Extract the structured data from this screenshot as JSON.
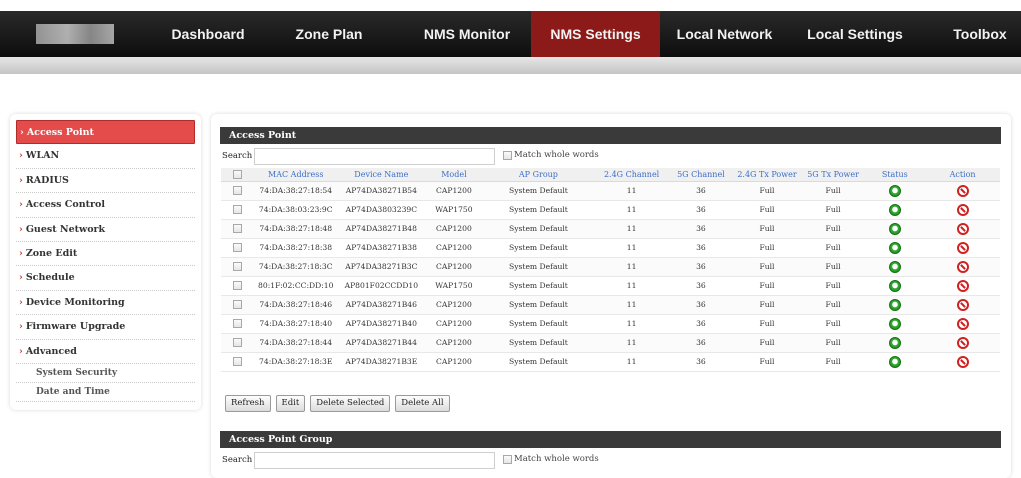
{
  "nav": {
    "logo_alt": "",
    "items": [
      "Dashboard",
      "Zone Plan",
      "NMS Monitor",
      "NMS Settings",
      "Local Network",
      "Local Settings",
      "Toolbox"
    ],
    "active_index": 3,
    "active_color": "#8b1a18"
  },
  "sidebar": {
    "items": [
      {
        "label": "Access Point",
        "active": true
      },
      {
        "label": "WLAN"
      },
      {
        "label": "RADIUS"
      },
      {
        "label": "Access Control"
      },
      {
        "label": "Guest Network"
      },
      {
        "label": "Zone Edit"
      },
      {
        "label": "Schedule"
      },
      {
        "label": "Device Monitoring"
      },
      {
        "label": "Firmware Upgrade"
      },
      {
        "label": "Advanced"
      }
    ],
    "sub_items": [
      "System Security",
      "Date and Time"
    ],
    "active_color": "#e44c4c"
  },
  "access_point": {
    "title": "Access Point",
    "search_label": "Search",
    "search_value": "",
    "match_label": "Match whole words",
    "columns": [
      "",
      "MAC Address",
      "Device Name",
      "Model",
      "AP Group",
      "2.4G Channel",
      "5G Channel",
      "2.4G Tx Power",
      "5G Tx Power",
      "Status",
      "Action"
    ],
    "rows": [
      {
        "mac": "74:DA:38:27:18:54",
        "name": "AP74DA38271B54",
        "model": "CAP1200",
        "group": "System Default",
        "ch24": "11",
        "ch5": "36",
        "tx24": "Full",
        "tx5": "Full"
      },
      {
        "mac": "74:DA:38:03:23:9C",
        "name": "AP74DA3803239C",
        "model": "WAP1750",
        "group": "System Default",
        "ch24": "11",
        "ch5": "36",
        "tx24": "Full",
        "tx5": "Full"
      },
      {
        "mac": "74:DA:38:27:18:48",
        "name": "AP74DA38271B48",
        "model": "CAP1200",
        "group": "System Default",
        "ch24": "11",
        "ch5": "36",
        "tx24": "Full",
        "tx5": "Full"
      },
      {
        "mac": "74:DA:38:27:18:38",
        "name": "AP74DA38271B38",
        "model": "CAP1200",
        "group": "System Default",
        "ch24": "11",
        "ch5": "36",
        "tx24": "Full",
        "tx5": "Full"
      },
      {
        "mac": "74:DA:38:27:18:3C",
        "name": "AP74DA38271B3C",
        "model": "CAP1200",
        "group": "System Default",
        "ch24": "11",
        "ch5": "36",
        "tx24": "Full",
        "tx5": "Full"
      },
      {
        "mac": "80:1F:02:CC:DD:10",
        "name": "AP801F02CCDD10",
        "model": "WAP1750",
        "group": "System Default",
        "ch24": "11",
        "ch5": "36",
        "tx24": "Full",
        "tx5": "Full"
      },
      {
        "mac": "74:DA:38:27:18:46",
        "name": "AP74DA38271B46",
        "model": "CAP1200",
        "group": "System Default",
        "ch24": "11",
        "ch5": "36",
        "tx24": "Full",
        "tx5": "Full"
      },
      {
        "mac": "74:DA:38:27:18:40",
        "name": "AP74DA38271B40",
        "model": "CAP1200",
        "group": "System Default",
        "ch24": "11",
        "ch5": "36",
        "tx24": "Full",
        "tx5": "Full"
      },
      {
        "mac": "74:DA:38:27:18:44",
        "name": "AP74DA38271B44",
        "model": "CAP1200",
        "group": "System Default",
        "ch24": "11",
        "ch5": "36",
        "tx24": "Full",
        "tx5": "Full"
      },
      {
        "mac": "74:DA:38:27:18:3E",
        "name": "AP74DA38271B3E",
        "model": "CAP1200",
        "group": "System Default",
        "ch24": "11",
        "ch5": "36",
        "tx24": "Full",
        "tx5": "Full"
      }
    ],
    "status_icon": "online-status-icon",
    "action_icon": "delete-icon",
    "buttons": [
      "Refresh",
      "Edit",
      "Delete Selected",
      "Delete All"
    ]
  },
  "access_point_group": {
    "title": "Access Point Group",
    "search_label": "Search",
    "search_value": "",
    "match_label": "Match whole words"
  }
}
